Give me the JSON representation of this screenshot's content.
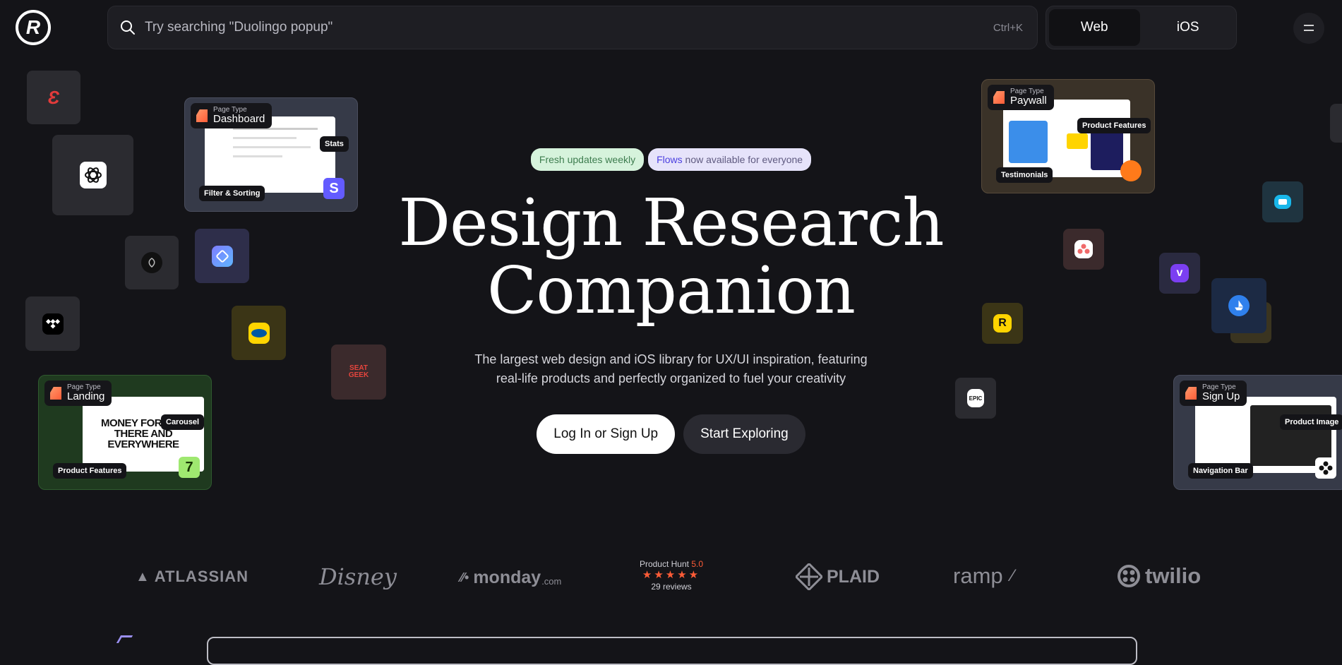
{
  "header": {
    "logo_text": "R",
    "search": {
      "placeholder": "Try searching \"Duolingo popup\"",
      "shortcut": "Ctrl+K"
    },
    "platform_tabs": [
      {
        "label": "Web",
        "active": true
      },
      {
        "label": "iOS",
        "active": false
      }
    ],
    "menu_icon": "hamburger-icon"
  },
  "hero": {
    "pill_1": "Fresh updates weekly",
    "pill_2_highlight": "Flows",
    "pill_2_rest": " now available for everyone",
    "title_line_1": "Design Research",
    "title_line_2": "Companion",
    "subtitle_line_1": "The largest web design and iOS library for UX/UI inspiration, featuring",
    "subtitle_line_2": "real-life products and perfectly organized to fuel your creativity",
    "cta_primary": "Log In or Sign Up",
    "cta_secondary": "Start Exploring"
  },
  "cards": {
    "dashboard": {
      "small": "Page Type",
      "big": "Dashboard",
      "tag_1": "Stats",
      "tag_2": "Filter & Sorting",
      "logo": "S"
    },
    "paywall": {
      "small": "Page Type",
      "big": "Paywall",
      "tag_1": "Product Features",
      "tag_2": "Testimonials"
    },
    "landing": {
      "small": "Page Type",
      "big": "Landing",
      "tag_1": "Carousel",
      "tag_2": "Product Features",
      "headline": "MONEY FOR HER THERE AND EVERYWHERE",
      "logo": "7"
    },
    "signup": {
      "small": "Page Type",
      "big": "Sign Up",
      "tag_1": "Product Image",
      "tag_2": "Navigation Bar"
    }
  },
  "app_tiles": {
    "seatgeek": "SEAT GEEK",
    "colors": {
      "accent_purple": "#5b5bf5",
      "ikea_yellow": "#ffd500",
      "rakuten_yellow": "#ffd400"
    }
  },
  "brands": {
    "atlassian": "ATLASSIAN",
    "disney": "Disney",
    "monday": "monday",
    "monday_suffix": ".com",
    "producthunt_label": "Product Hunt",
    "producthunt_score": "5.0",
    "producthunt_stars": "★★★★★",
    "producthunt_reviews": "29 reviews",
    "plaid": "PLAID",
    "ramp": "ramp",
    "twilio": "twilio"
  }
}
